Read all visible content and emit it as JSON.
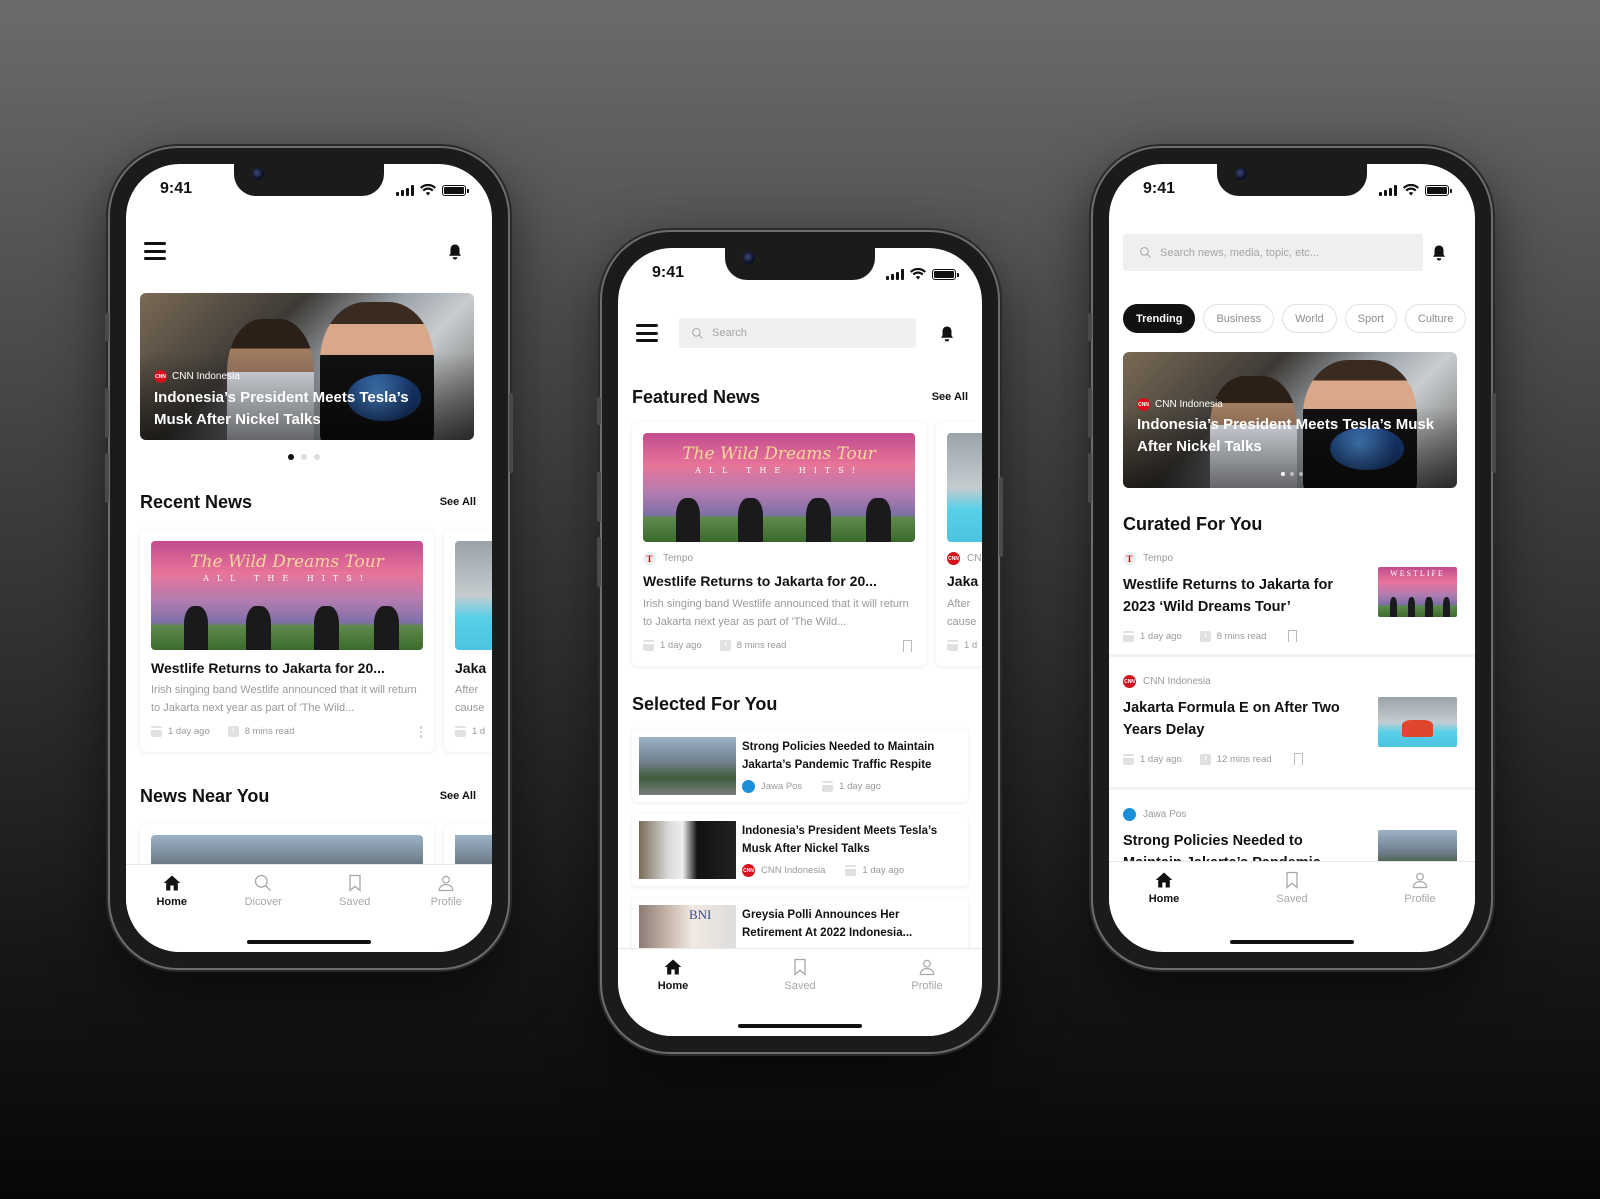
{
  "status_bar": {
    "time": "9:41"
  },
  "phone1": {
    "hero": {
      "source": "CNN Indonesia",
      "title": "Indonesia’s President Meets Tesla’s Musk After Nickel Talks",
      "active_dot": 1,
      "dot_count": 3
    },
    "recent_news": {
      "title": "Recent News",
      "see_all": "See All",
      "cards": [
        {
          "image_title": "The Wild Dreams Tour",
          "image_subtitle": "ALL THE HITS!",
          "title": "Westlife Returns to Jakarta for 20...",
          "desc": "Irish singing band Westlife announced that it will return to Jakarta next year as part of 'The Wild...",
          "date": "1 day ago",
          "read": "8 mins read"
        },
        {
          "title": "Jaka",
          "desc": "After cause",
          "date": "1 d"
        }
      ]
    },
    "news_near_you": {
      "title": "News Near You",
      "see_all": "See All"
    },
    "tabs": [
      {
        "label": "Home",
        "icon": "home-icon",
        "active": true
      },
      {
        "label": "Dicover",
        "icon": "search-icon",
        "active": false
      },
      {
        "label": "Saved",
        "icon": "bookmark-icon",
        "active": false
      },
      {
        "label": "Profile",
        "icon": "user-icon",
        "active": false
      }
    ]
  },
  "phone2": {
    "search_placeholder": "Search",
    "featured": {
      "title": "Featured News",
      "see_all": "See All",
      "cards": [
        {
          "image_title": "The Wild Dreams Tour",
          "image_subtitle": "ALL THE HITS!",
          "source": "Tempo",
          "title": "Westlife Returns to Jakarta for 20...",
          "desc": "Irish singing band Westlife announced that it will return to Jakarta next year as part of 'The Wild...",
          "date": "1 day ago",
          "read": "8 mins read"
        },
        {
          "source": "CN",
          "title": "Jaka",
          "desc": "After cause",
          "date": "1 d"
        }
      ]
    },
    "selected": {
      "title": "Selected For You",
      "items": [
        {
          "title": "Strong Policies Needed to Maintain Jakarta’s Pandemic Traffic Respite",
          "source": "Jawa Pos",
          "date": "1 day ago"
        },
        {
          "title": "Indonesia’s President Meets Tesla’s Musk After Nickel Talks",
          "source": "CNN Indonesia",
          "date": "1 day ago"
        },
        {
          "title": "Greysia Polli Announces Her Retirement At 2022 Indonesia...",
          "image_text": "BNI"
        }
      ]
    },
    "tabs": [
      {
        "label": "Home",
        "icon": "home-icon",
        "active": true
      },
      {
        "label": "Saved",
        "icon": "bookmark-icon",
        "active": false
      },
      {
        "label": "Profile",
        "icon": "user-icon",
        "active": false
      }
    ]
  },
  "phone3": {
    "search_placeholder": "Search news, media, topic, etc...",
    "chips": [
      {
        "label": "Trending",
        "active": true
      },
      {
        "label": "Business",
        "active": false
      },
      {
        "label": "World",
        "active": false
      },
      {
        "label": "Sport",
        "active": false
      },
      {
        "label": "Culture",
        "active": false
      }
    ],
    "hero": {
      "source": "CNN Indonesia",
      "title": "Indonesia’s President Meets Tesla’s Musk After Nickel Talks",
      "active_dot": 1,
      "dot_count": 3
    },
    "curated": {
      "title": "Curated For You",
      "items": [
        {
          "source": "Tempo",
          "title": "Westlife Returns to Jakarta for 2023 ‘Wild Dreams Tour’",
          "date": "1 day ago",
          "read": "8 mins read",
          "image_text": "WESTLIFE"
        },
        {
          "source": "CNN Indonesia",
          "title": "Jakarta Formula E on After Two Years Delay",
          "date": "1 day ago",
          "read": "12 mins read"
        },
        {
          "source": "Jawa Pos",
          "title": "Strong Policies Needed to Maintain Jakarta’s Pandemic..."
        }
      ]
    },
    "tabs": [
      {
        "label": "Home",
        "icon": "home-icon",
        "active": true
      },
      {
        "label": "Saved",
        "icon": "bookmark-icon",
        "active": false
      },
      {
        "label": "Profile",
        "icon": "user-icon",
        "active": false
      }
    ]
  },
  "colors": {
    "brand_red": "#d4111d",
    "jawa_blue": "#1b8fd8",
    "active_chip": "#111111",
    "muted_text": "#9a9a9a"
  }
}
